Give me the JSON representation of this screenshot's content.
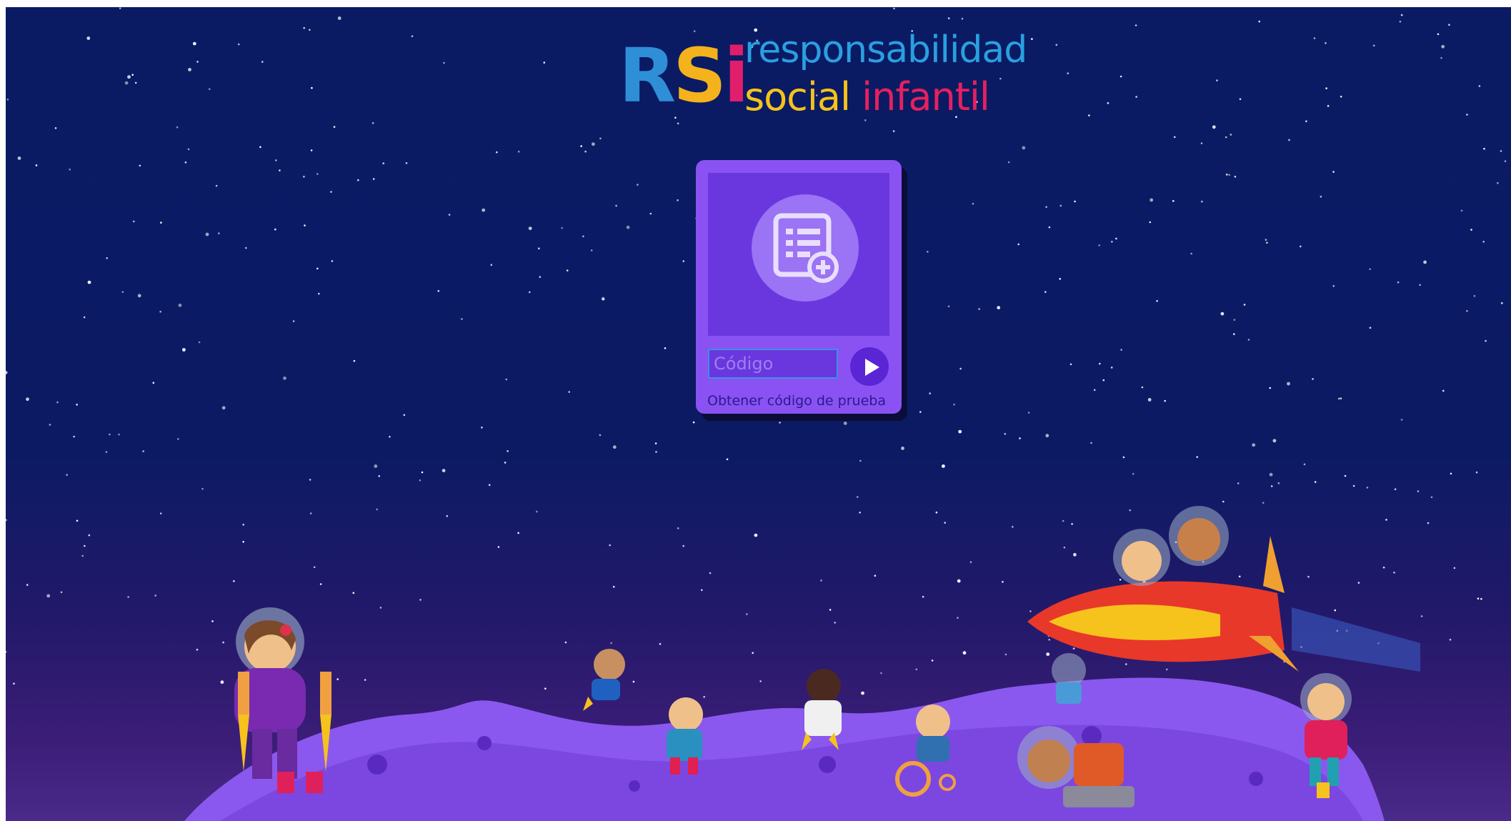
{
  "logo": {
    "mark_r": "R",
    "mark_s": "S",
    "mark_i": "i",
    "line1": "responsabilidad",
    "line2_a": "social",
    "line2_b": "infantil"
  },
  "login": {
    "code_placeholder": "Código",
    "code_value": "",
    "submit_icon": "play-icon",
    "trial_link": "Obtener código de prueba"
  },
  "icons": {
    "form": "form-add-icon"
  },
  "colors": {
    "sky": "#0c1a64",
    "card": "#8a52f2",
    "panel": "#6a37df",
    "ground": "#8a58ee",
    "logo_blue": "#2f8fd6",
    "logo_yellow": "#f4b21d",
    "logo_pink": "#e11e6b"
  }
}
